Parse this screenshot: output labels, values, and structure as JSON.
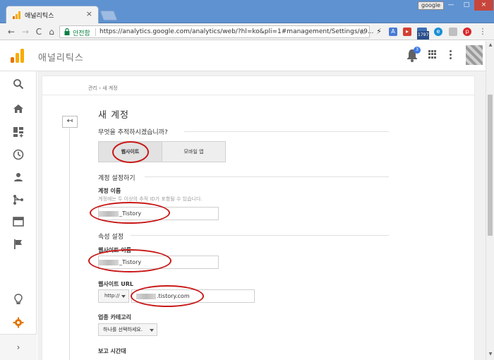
{
  "browser": {
    "tab_title": "애널리틱스",
    "tab_close": "×",
    "profile": "google",
    "window_controls": {
      "minimize": "—",
      "maximize": "□",
      "close": "×"
    },
    "back": "←",
    "forward": "→",
    "reload": "C",
    "home": "⌂",
    "secure_label": "안전함",
    "url": "https://analytics.google.com/analytics/web/?hl=ko&pli=1#management/Settings/a9...",
    "bookmark_star": "☆",
    "extension_badge": "1797"
  },
  "app": {
    "title": "애널리틱스",
    "notification_count": "3"
  },
  "nav": {
    "expand": "›"
  },
  "page": {
    "breadcrumb": "관리 › 새 계정",
    "back_arrow": "↤",
    "heading": "새 계정",
    "track_question": "무엇을 추적하시겠습니까?",
    "track_options": [
      "웹사이트",
      "모바일 앱"
    ],
    "account_settings": {
      "title": "계정 설정하기",
      "account_name_label": "계정 이름",
      "account_name_help": "계정에는 두 이상의 추적 ID가 포함될 수 있습니다.",
      "account_name_value": "_Tistory"
    },
    "property_settings": {
      "title": "속성 설정",
      "site_name_label": "웹사이트 이름",
      "site_name_value": "_Tistory",
      "site_url_label": "웹사이트 URL",
      "protocol": "http://",
      "site_url_value": ".tistory.com",
      "category_label": "업종 카테고리",
      "category_placeholder": "하나를 선택하세요.",
      "timezone_label": "보고 시간대"
    }
  },
  "colors": {
    "annotation_ring": "#c91818",
    "chrome_frame": "#5f92d1",
    "secure_green": "#0b8043",
    "ga_orange": "#f9ab00",
    "active_nav_orange": "#e37400"
  }
}
